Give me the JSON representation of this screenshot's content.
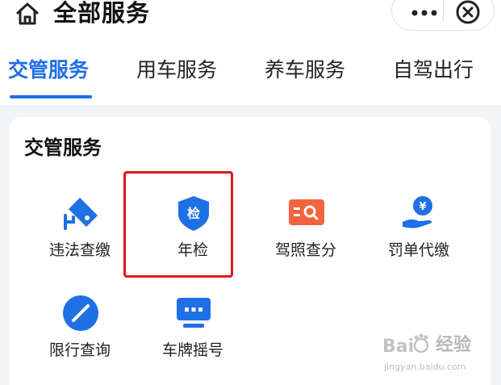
{
  "header": {
    "title": "全部服务",
    "icons": {
      "home": "home-icon",
      "more": "more-dots-icon",
      "close": "close-circle-icon"
    }
  },
  "tabs": [
    {
      "label": "交管服务",
      "active": true
    },
    {
      "label": "用车服务",
      "active": false
    },
    {
      "label": "养车服务",
      "active": false
    },
    {
      "label": "自驾出行",
      "active": false
    }
  ],
  "section": {
    "title": "交管服务",
    "items": [
      {
        "label": "违法查缴",
        "icon": "camera-icon"
      },
      {
        "label": "年检",
        "icon": "shield-icon",
        "icon_text": "检",
        "highlighted": true
      },
      {
        "label": "驾照查分",
        "icon": "license-card-icon"
      },
      {
        "label": "罚单代缴",
        "icon": "yuan-hand-icon",
        "icon_text": "¥"
      },
      {
        "label": "限行查询",
        "icon": "no-entry-icon"
      },
      {
        "label": "车牌摇号",
        "icon": "license-plate-icon"
      }
    ]
  },
  "colors": {
    "accent": "#1f6fe5",
    "orange": "#f2643d",
    "highlight": "#e0191f"
  },
  "watermark": {
    "text": "经验",
    "url": "jingyan.baidu.com"
  }
}
